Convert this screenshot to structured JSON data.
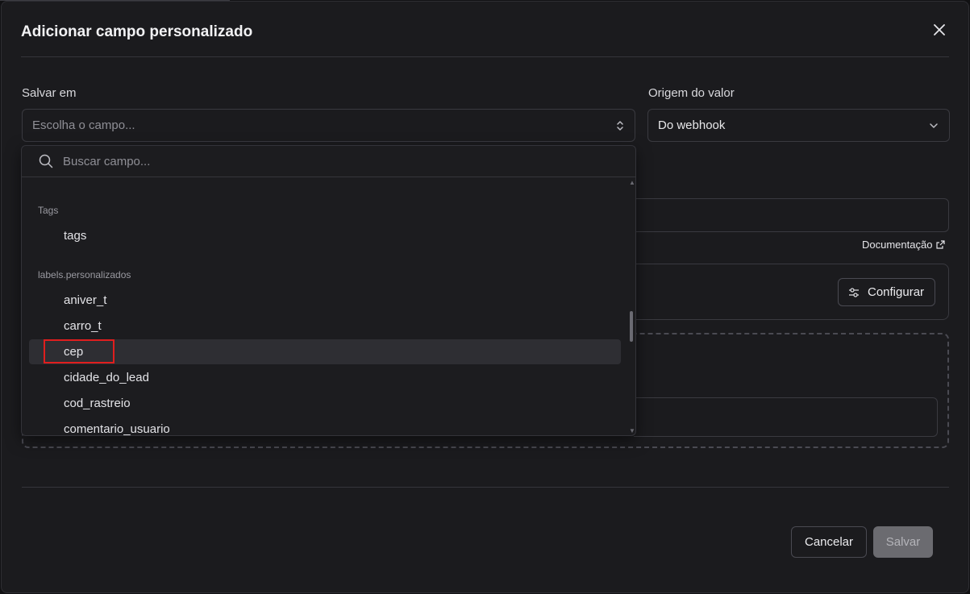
{
  "modal": {
    "title": "Adicionar campo personalizado"
  },
  "form": {
    "save_in_label": "Salvar em",
    "save_in_placeholder": "Escolha o campo...",
    "value_source_label": "Origem do valor",
    "value_source_value": "Do webhook",
    "doc_link": "Documentação",
    "configure_button": "Configurar"
  },
  "dropdown": {
    "search_placeholder": "Buscar campo...",
    "groups": [
      {
        "label": "Tags",
        "items": [
          "tags"
        ]
      },
      {
        "label": "labels.personalizados",
        "items": [
          "aniver_t",
          "carro_t",
          "cep",
          "cidade_do_lead",
          "cod_rastreio",
          "comentario_usuario"
        ]
      }
    ],
    "highlighted_item": "cep"
  },
  "footer": {
    "cancel_button": "Cancelar",
    "save_button": "Salvar"
  },
  "colors": {
    "background": "#1b1b1e",
    "highlight_box": "#e01e1e",
    "save_disabled": "#6b6b70"
  }
}
